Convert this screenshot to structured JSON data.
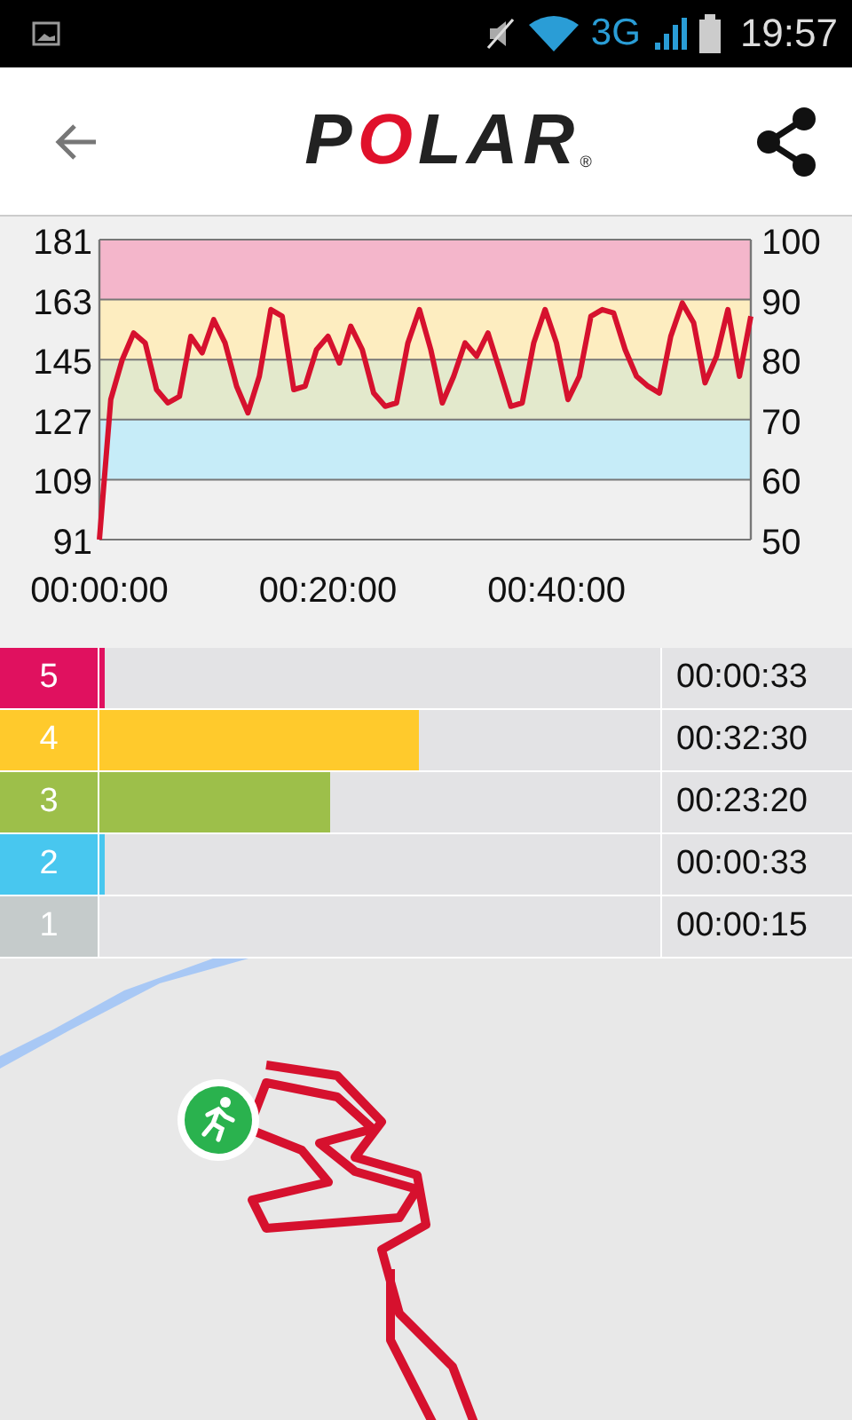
{
  "status_bar": {
    "network": "3G",
    "time": "19:57"
  },
  "header": {
    "logo": "POLAR",
    "logo_mark": "®"
  },
  "chart": {
    "chart_data": {
      "type": "line",
      "x": [
        0,
        1,
        2,
        3,
        4,
        5,
        6,
        7,
        8,
        9,
        10,
        11,
        12,
        13,
        14,
        15,
        16,
        17,
        18,
        19,
        20,
        21,
        22,
        23,
        24,
        25,
        26,
        27,
        28,
        29,
        30,
        31,
        32,
        33,
        34,
        35,
        36,
        37,
        38,
        39,
        40,
        41,
        42,
        43,
        44,
        45,
        46,
        47,
        48,
        49,
        50,
        51,
        52,
        53,
        54,
        55,
        56,
        57
      ],
      "xlim": [
        0,
        57
      ],
      "ylim": [
        91,
        181
      ],
      "xticks": [
        {
          "value": 0,
          "label": "00:00:00"
        },
        {
          "value": 20,
          "label": "00:20:00"
        },
        {
          "value": 40,
          "label": "00:40:00"
        }
      ],
      "yticks": [
        91,
        109,
        127,
        145,
        163,
        181
      ],
      "bands": [
        {
          "axis": "y",
          "from": 163,
          "to": 181,
          "color": "#f4b6cb"
        },
        {
          "axis": "y",
          "from": 145,
          "to": 163,
          "color": "#fdedc0"
        },
        {
          "axis": "y",
          "from": 127,
          "to": 145,
          "color": "#e3e9cc"
        },
        {
          "axis": "y",
          "from": 109,
          "to": 127,
          "color": "#c6ecf8"
        }
      ],
      "grid": true,
      "series": [
        {
          "color": "#d6112e",
          "values": [
            91,
            133,
            145,
            153,
            150,
            136,
            132,
            134,
            152,
            147,
            157,
            150,
            137,
            129,
            140,
            160,
            158,
            136,
            137,
            148,
            152,
            144,
            155,
            148,
            135,
            131,
            132,
            150,
            160,
            148,
            132,
            140,
            150,
            146,
            153,
            142,
            131,
            132,
            150,
            160,
            150,
            133,
            140,
            158,
            160,
            159,
            148,
            140,
            137,
            135,
            152,
            162,
            156,
            138,
            146,
            160,
            140,
            158
          ]
        }
      ]
    },
    "right_ticks": [
      "100",
      "90",
      "80",
      "70",
      "60",
      "50"
    ]
  },
  "zones": [
    {
      "number": "5",
      "color": "#e0115f",
      "level": 0.01,
      "time": "00:00:33"
    },
    {
      "number": "4",
      "color": "#ffca2c",
      "level": 0.57,
      "time": "00:32:30"
    },
    {
      "number": "3",
      "color": "#9dbf4a",
      "level": 0.41,
      "time": "00:23:20"
    },
    {
      "number": "2",
      "color": "#48c7ef",
      "level": 0.01,
      "time": "00:00:33"
    },
    {
      "number": "1",
      "color": "#c5cbcb",
      "time": "00:00:15"
    }
  ]
}
